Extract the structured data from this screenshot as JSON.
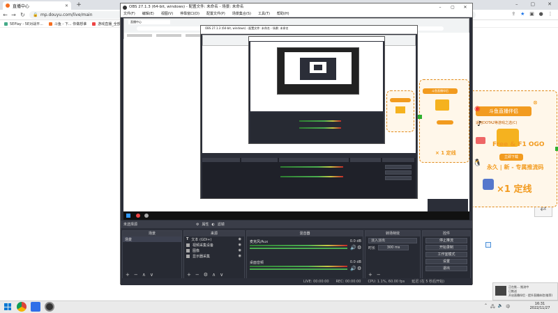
{
  "browser": {
    "tab_title": "直播中心",
    "tab_close": "✕",
    "new_tab": "+",
    "url": "mp.douyu.com/live/main",
    "bookmarks": [
      "5EPlay - 5E对战平...",
      "斗鱼 - 下... 你做想谁",
      "游戏直播_全部"
    ]
  },
  "obs": {
    "title": "OBS 27.1.3 (64-bit, windows) - 配置文件: 未命名 - 场景: 未命名",
    "menu": [
      "文件(F)",
      "编辑(E)",
      "视图(V)",
      "停靠窗口(D)",
      "配置文件(P)",
      "场景集合(S)",
      "工具(T)",
      "帮助(H)"
    ],
    "scene_bar": [
      "未选择源",
      "属性",
      "滤镜"
    ],
    "docks": {
      "scenes": {
        "title": "场景",
        "items": [
          "场景"
        ]
      },
      "sources": {
        "title": "来源",
        "items": [
          "文本 (GDI+)",
          "视频采集设备",
          "图像",
          "显示器采集"
        ]
      },
      "mixer": {
        "title": "混音器",
        "channels": [
          {
            "name": "桌面音频",
            "level": "0.0 dB"
          },
          {
            "name": "麦克风/Aux",
            "level": "0.0 dB"
          }
        ]
      },
      "transitions": {
        "title": "转场特效",
        "type": "淡入淡出",
        "duration_label": "时长",
        "duration": "300 ms"
      },
      "controls": {
        "title": "控件",
        "buttons": [
          "停止推流",
          "开始录制",
          "工作室模式",
          "设置",
          "退出"
        ]
      }
    },
    "status": {
      "live": "LIVE: 00:00:00",
      "rec": "REC: 00:00:00",
      "cpu": "CPU: 1.1%, 60.00 fps",
      "delay": "延迟 (在 5 秒后开始)"
    }
  },
  "overlay": {
    "badge_title": "斗鱼直播伴侣",
    "platform_text": "适用DOTA2等游戏之选(C)",
    "free_text": "Free & F1 OGO",
    "button": "立即下载",
    "promo1": "永久 | 新 - 专属推流码",
    "promo2": "×1 定线",
    "promo_mini": "× 1 定线"
  },
  "nested": {
    "tab_title": "直播中心",
    "obs_title": "OBS 27.1.3 (64-bit, windows) - 配置文件: 未命名 - 场景: 未命名"
  },
  "notification": {
    "line1": "正在推... 推流中",
    "line2": "已推送",
    "line3": "开启直播伴侣 - 提升直播体验(推荐)"
  },
  "clock": {
    "time": "16:31",
    "date": "2022/11/27"
  },
  "colors": {
    "obs_bg": "#2b2e38",
    "accent": "#f29b1f",
    "green": "#2fb12f"
  }
}
